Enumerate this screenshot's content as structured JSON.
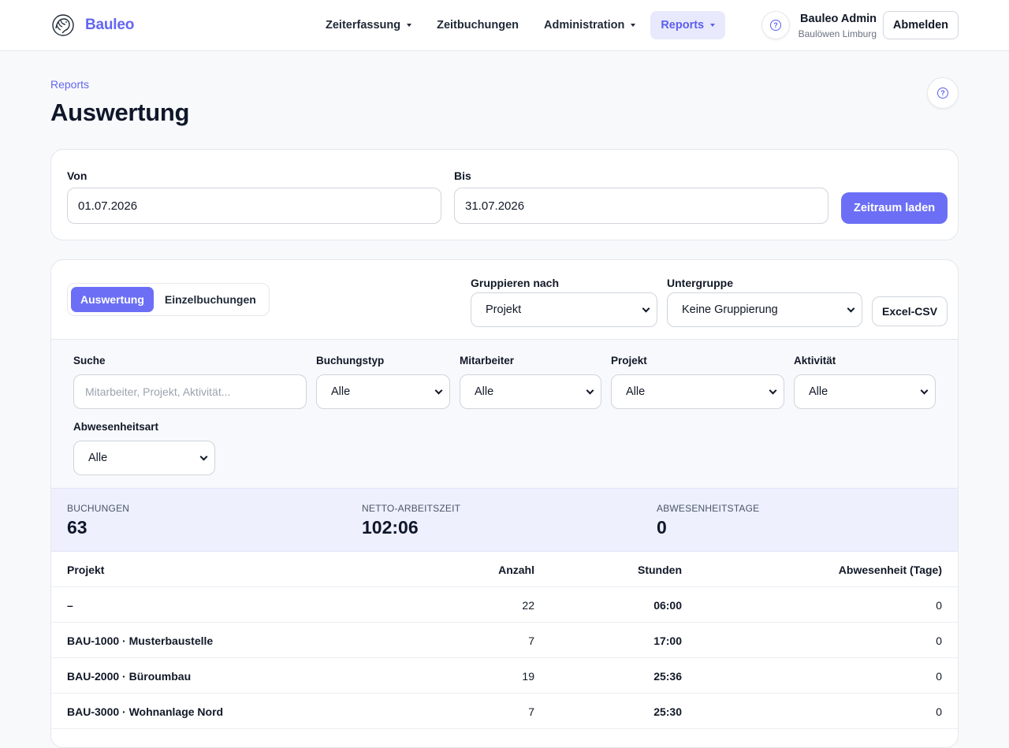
{
  "header": {
    "brand": "Bauleo",
    "nav": [
      {
        "label": "Zeiterfassung",
        "dropdown": true
      },
      {
        "label": "Zeitbuchungen",
        "dropdown": false
      },
      {
        "label": "Administration",
        "dropdown": true
      },
      {
        "label": "Reports",
        "dropdown": true,
        "active": true
      }
    ],
    "user_name": "Bauleo Admin",
    "user_org": "Baulöwen Limburg",
    "logout_label": "Abmelden"
  },
  "page": {
    "breadcrumb": "Reports",
    "title": "Auswertung"
  },
  "range": {
    "from_label": "Von",
    "from_value": "01.07.2026",
    "to_label": "Bis",
    "to_value": "31.07.2026",
    "load_label": "Zeitraum laden"
  },
  "view": {
    "tabs": [
      {
        "label": "Auswertung",
        "active": true
      },
      {
        "label": "Einzelbuchungen",
        "active": false
      }
    ],
    "group_label": "Gruppieren nach",
    "group_value": "Projekt",
    "subgroup_label": "Untergruppe",
    "subgroup_value": "Keine Gruppierung",
    "export_label": "Excel-CSV"
  },
  "filters": {
    "search_label": "Suche",
    "search_placeholder": "Mitarbeiter, Projekt, Aktivität...",
    "booking_type_label": "Buchungstyp",
    "booking_type_value": "Alle",
    "employee_label": "Mitarbeiter",
    "employee_value": "Alle",
    "project_label": "Projekt",
    "project_value": "Alle",
    "activity_label": "Aktivität",
    "activity_value": "Alle",
    "absence_label": "Abwesenheitsart",
    "absence_value": "Alle"
  },
  "stats": [
    {
      "label": "BUCHUNGEN",
      "value": "63"
    },
    {
      "label": "NETTO-ARBEITSZEIT",
      "value": "102:06"
    },
    {
      "label": "ABWESENHEITSTAGE",
      "value": "0"
    }
  ],
  "table": {
    "columns": [
      "Projekt",
      "Anzahl",
      "Stunden",
      "Abwesenheit (Tage)"
    ],
    "rows": [
      [
        "–",
        "22",
        "06:00",
        "0"
      ],
      [
        "BAU-1000 · Musterbaustelle",
        "7",
        "17:00",
        "0"
      ],
      [
        "BAU-2000 · Büroumbau",
        "19",
        "25:36",
        "0"
      ],
      [
        "BAU-3000 · Wohnanlage Nord",
        "7",
        "25:30",
        "0"
      ]
    ]
  },
  "colors": {
    "accent": "#6c6ff5",
    "accent_text": "#6366f1",
    "stats_bg": "#eef0fe"
  }
}
